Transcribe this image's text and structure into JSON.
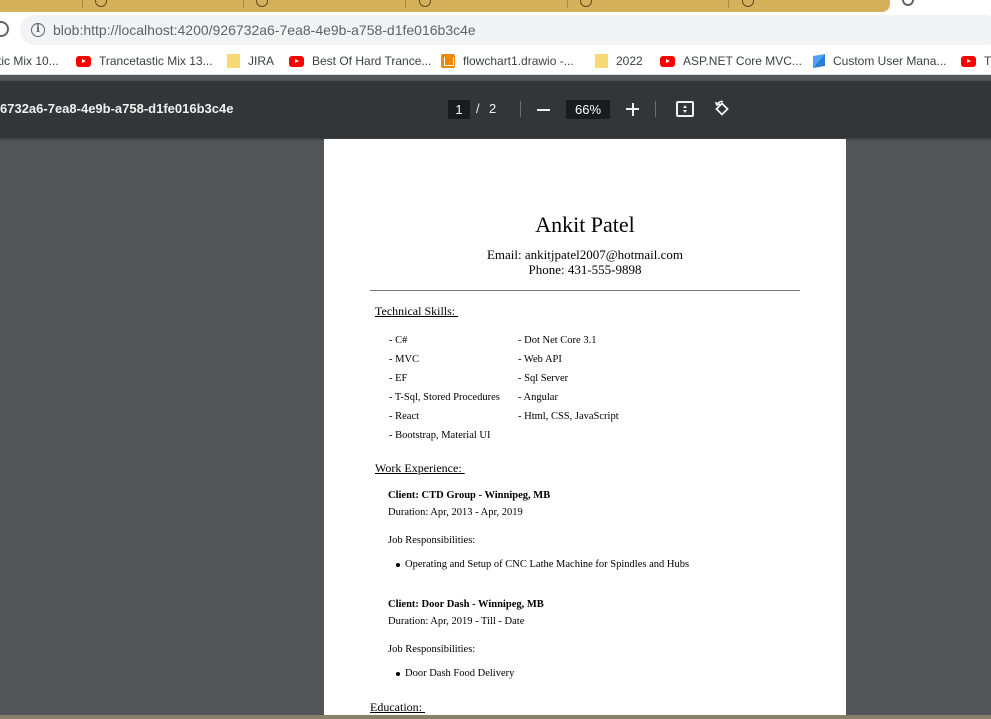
{
  "browser": {
    "url": "blob:http://localhost:4200/926732a6-7ea8-4e9b-a758-d1fe016b3c4e",
    "accent_color": "#d5b05a",
    "bookmarks": [
      {
        "label": "tic Mix 10...",
        "icon": "youtube-icon"
      },
      {
        "label": "Trancetastic Mix 13...",
        "icon": "youtube-icon"
      },
      {
        "label": "JIRA",
        "icon": "folder-icon"
      },
      {
        "label": "Best Of Hard Trance...",
        "icon": "youtube-icon"
      },
      {
        "label": "flowchart1.drawio -...",
        "icon": "drawio-icon"
      },
      {
        "label": "2022",
        "icon": "folder-icon"
      },
      {
        "label": "ASP.NET Core MVC...",
        "icon": "youtube-icon"
      },
      {
        "label": "Custom User Mana...",
        "icon": "microsoft-icon"
      },
      {
        "label": "T",
        "icon": "youtube-icon"
      }
    ]
  },
  "pdf_toolbar": {
    "title": "6732a6-7ea8-4e9b-a758-d1fe016b3c4e",
    "current_page": "1",
    "page_separator": "/",
    "total_pages": "2",
    "zoom": "66%"
  },
  "resume": {
    "name": "Ankit Patel",
    "email": "Email: ankitjpatel2007@hotmail.com",
    "phone": "Phone: 431-555-9898",
    "skills_heading": "Technical Skills: ",
    "skills_left": [
      "- C#",
      "- MVC",
      "- EF",
      "- T-Sql, Stored Procedures",
      "- React",
      "- Bootstrap, Material UI"
    ],
    "skills_right": [
      "- Dot Net Core 3.1",
      "- Web API",
      "- Sql Server",
      "- Angular",
      "- Html, CSS, JavaScript"
    ],
    "work_heading": "Work Experience: ",
    "jobs": [
      {
        "client": "Client: CTD Group - Winnipeg, MB",
        "duration": "Duration: Apr, 2013 - Apr, 2019",
        "resp_heading": "Job Responsibilities:",
        "responsibilities": [
          "Operating and Setup of CNC Lathe Machine for Spindles and Hubs"
        ]
      },
      {
        "client": "Client: Door Dash - Winnipeg, MB",
        "duration": "Duration: Apr, 2019 - Till - Date",
        "resp_heading": "Job Responsibilities:",
        "responsibilities": [
          "Door Dash Food Delivery"
        ]
      }
    ],
    "education_heading": "Education: "
  }
}
